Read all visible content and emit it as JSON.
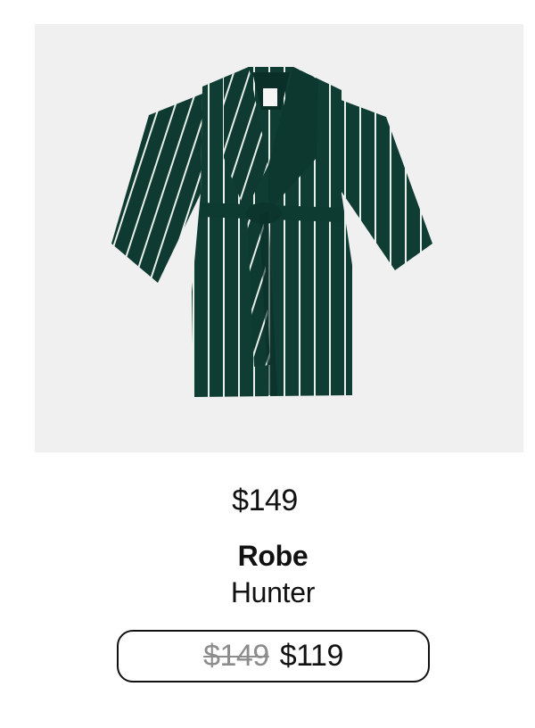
{
  "product": {
    "image_alt": "Hunter striped robe",
    "price": "$149",
    "name": "Robe",
    "variant": "Hunter",
    "original_price": "$149",
    "sale_price": "$119",
    "colors": {
      "robe": "#0f3d33",
      "stripe": "#e9efe9",
      "image_background": "#f0f0f0",
      "strikethrough_text": "#8c8c8c"
    }
  }
}
